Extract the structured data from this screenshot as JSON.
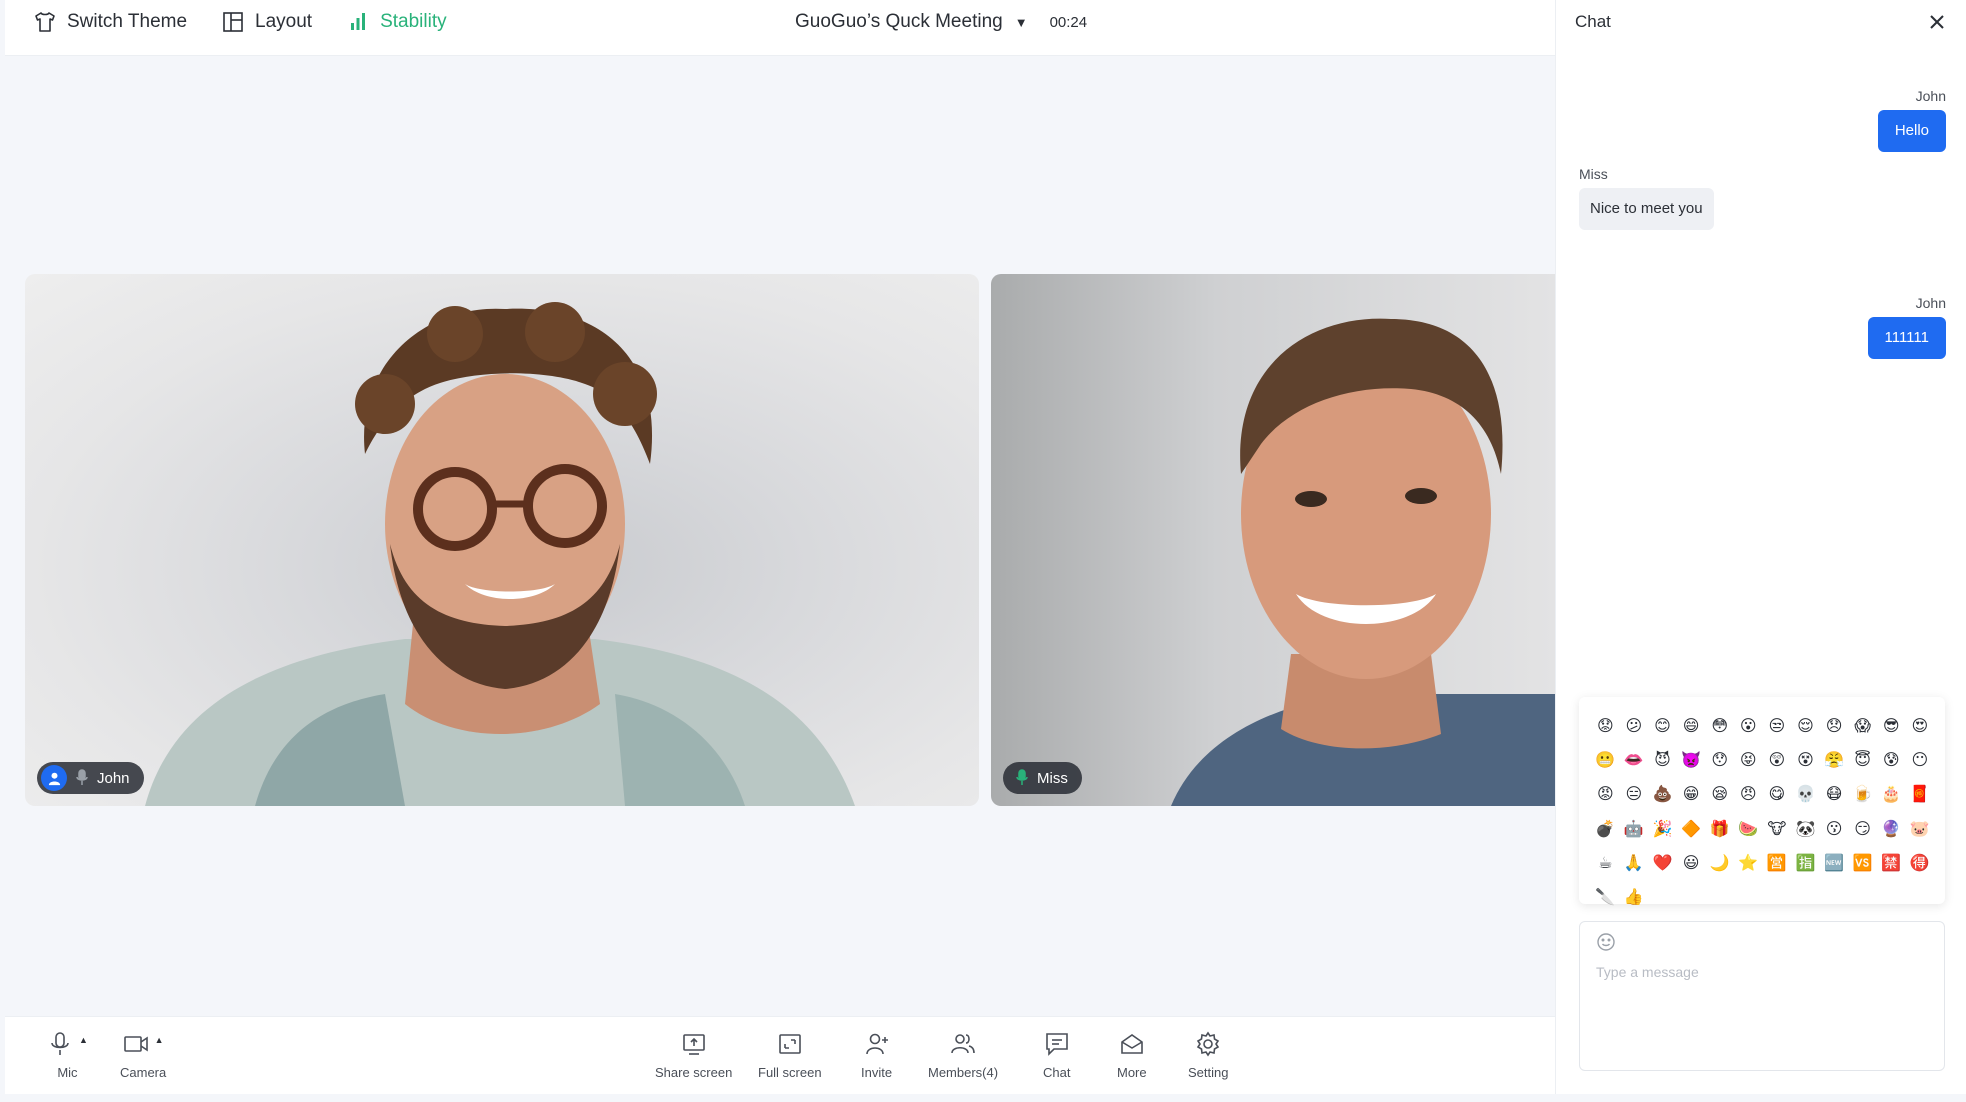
{
  "topbar": {
    "switch_theme": "Switch Theme",
    "layout": "Layout",
    "stability": "Stability",
    "meeting_title": "GuoGuo’s Quck Meeting",
    "timer": "00:24"
  },
  "tiles": [
    {
      "name": "John"
    },
    {
      "name": "Miss"
    }
  ],
  "toolbar": {
    "mic": "Mic",
    "camera": "Camera",
    "share_screen": "Share screen",
    "full_screen": "Full screen",
    "invite": "Invite",
    "members": "Members(4)",
    "chat": "Chat",
    "more": "More",
    "setting": "Setting"
  },
  "chat": {
    "title": "Chat",
    "messages": [
      {
        "sender": "John",
        "text": "Hello",
        "direction": "out"
      },
      {
        "sender": "Miss",
        "text": "Nice to meet you",
        "direction": "in"
      },
      {
        "sender": "John",
        "text": "111111",
        "direction": "out"
      }
    ],
    "emojis": [
      "😟",
      "😕",
      "😊",
      "😄",
      "😳",
      "😮",
      "😒",
      "😌",
      "😞",
      "😱",
      "😎",
      "😍",
      "😬",
      "👄",
      "😈",
      "👿",
      "😯",
      "😝",
      "😲",
      "😵",
      "😤",
      "😇",
      "😰",
      "😶",
      "😡",
      "😑",
      "💩",
      "😁",
      "😪",
      "😠",
      "😋",
      "💀",
      "😷",
      "🍺",
      "🎂",
      "🧧",
      "💣",
      "🤖",
      "🎉",
      "🔶",
      "🎁",
      "🍉",
      "🐮",
      "🐼",
      "😗",
      "😏",
      "🔮",
      "🐷",
      "☕",
      "🙏",
      "❤️",
      "😃",
      "🌙",
      "⭐",
      "🈺",
      "🈯",
      "🆕",
      "🆚",
      "🈲",
      "🉐",
      "🔪",
      "👍"
    ],
    "input_placeholder": "Type a message"
  },
  "colors": {
    "accent": "#1f6bf1",
    "stability_green": "#29b27a",
    "background": "#f4f6fa"
  }
}
